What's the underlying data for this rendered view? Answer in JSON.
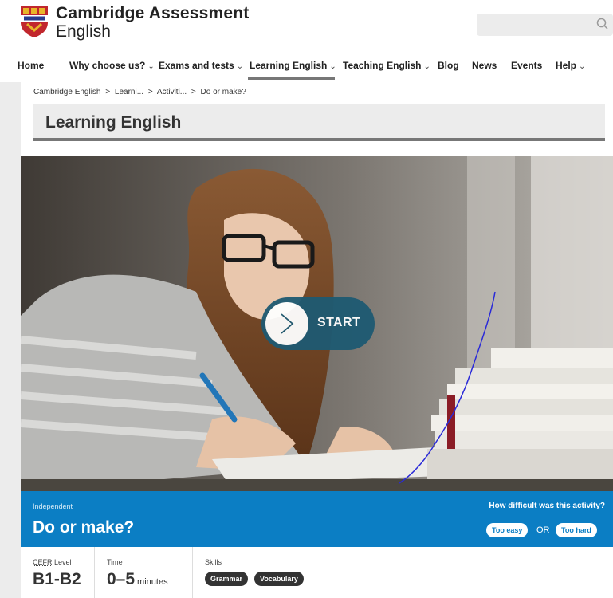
{
  "header": {
    "logo_line1": "Cambridge Assessment",
    "logo_line2": "English",
    "search_placeholder": ""
  },
  "nav": {
    "items": [
      {
        "label": "Home",
        "dropdown": false
      },
      {
        "label": "Why choose us?",
        "dropdown": true
      },
      {
        "label": "Exams and tests",
        "dropdown": true
      },
      {
        "label": "Learning English",
        "dropdown": true,
        "active": true
      },
      {
        "label": "Teaching English",
        "dropdown": true
      },
      {
        "label": "Blog",
        "dropdown": false
      },
      {
        "label": "News",
        "dropdown": false
      },
      {
        "label": "Events",
        "dropdown": false
      },
      {
        "label": "Help",
        "dropdown": true
      }
    ]
  },
  "breadcrumb": [
    "Cambridge English",
    "Learni...",
    "Activiti...",
    "Do or make?"
  ],
  "breadcrumb_sep": ">",
  "section": {
    "title": "Learning English"
  },
  "hero": {
    "start_label": "START"
  },
  "activity": {
    "level": "Independent",
    "title": "Do or make?",
    "feedback_question": "How difficult was this activity?",
    "too_easy": "Too easy",
    "or": "OR",
    "too_hard": "Too hard"
  },
  "meta": {
    "cefr_abbr": "CEFR",
    "cefr_label": "Level",
    "cefr_value": "B1-B2",
    "time_label": "Time",
    "time_value": "0–5",
    "time_unit": "minutes",
    "skills_label": "Skills",
    "skills": [
      "Grammar",
      "Vocabulary"
    ]
  },
  "colors": {
    "band_blue": "#0b7ec4",
    "start_teal": "#1e5a72",
    "nav_active": "#777777"
  }
}
